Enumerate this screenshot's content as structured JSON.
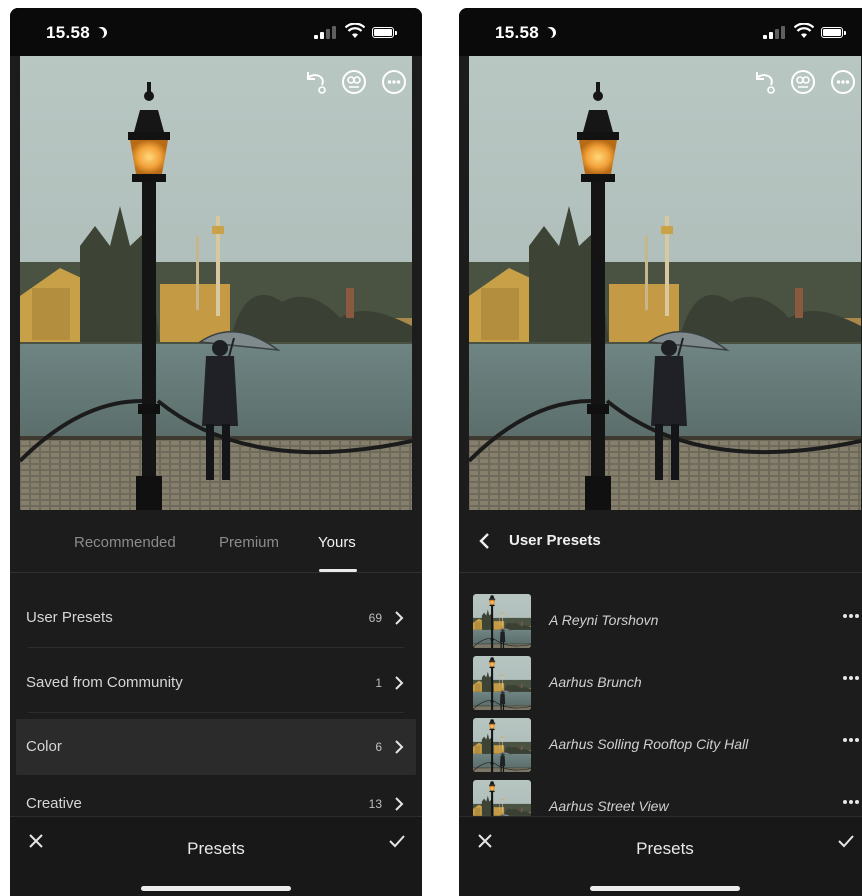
{
  "status_bar": {
    "time": "15.58"
  },
  "colors": {
    "panel": "#1c1c1c",
    "accent": "#e9e9e9",
    "muted_text": "#8b8b8b"
  },
  "left_screen": {
    "tabs": [
      {
        "label": "Recommended",
        "active": false
      },
      {
        "label": "Premium",
        "active": false
      },
      {
        "label": "Yours",
        "active": true
      }
    ],
    "list": [
      {
        "label": "User Presets",
        "count": "69"
      },
      {
        "label": "Saved from Community",
        "count": "1"
      },
      {
        "label": "Color",
        "count": "6",
        "selected": true
      },
      {
        "label": "Creative",
        "count": "13"
      }
    ]
  },
  "right_screen": {
    "header": {
      "title": "User Presets"
    },
    "presets": [
      {
        "name": "A Reyni Torshovn"
      },
      {
        "name": "Aarhus Brunch"
      },
      {
        "name": "Aarhus Solling Rooftop City Hall"
      },
      {
        "name": "Aarhus Street View"
      }
    ]
  },
  "bottom_bar": {
    "title": "Presets"
  },
  "icons": [
    "undo-icon",
    "people-icon",
    "more-icon",
    "back-chevron-icon",
    "chevron-right-icon",
    "close-icon",
    "checkmark-icon"
  ]
}
